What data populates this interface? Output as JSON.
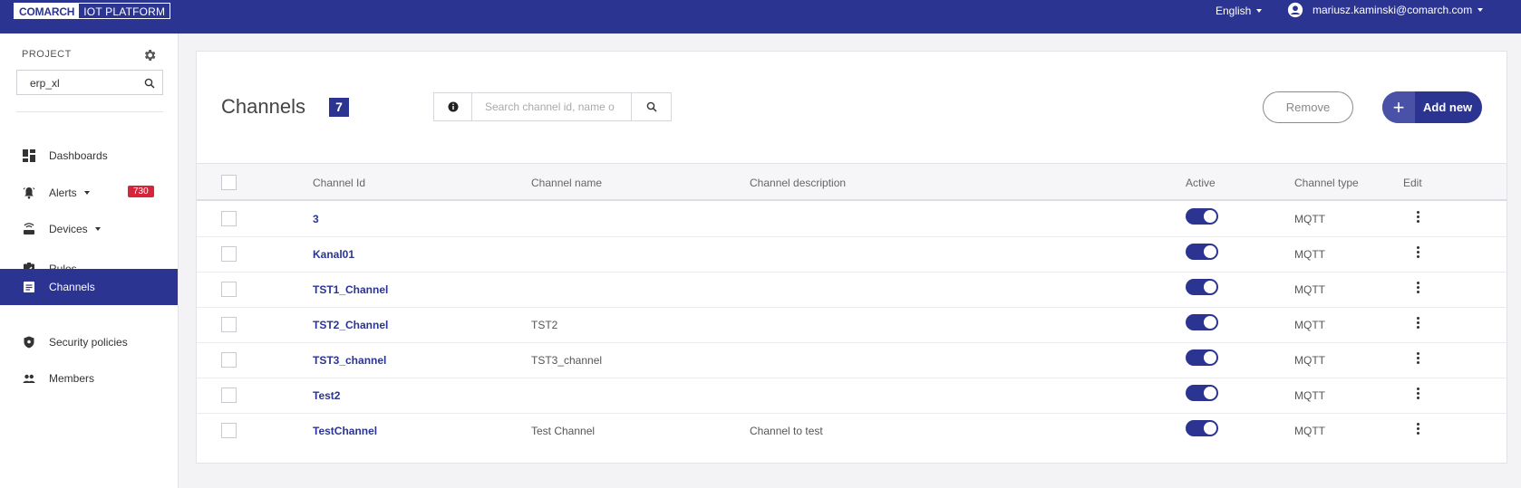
{
  "topbar": {
    "logo_brand": "COMARCH",
    "logo_product": "IOT PLATFORM",
    "language": "English",
    "user_email": "mariusz.kaminski@comarch.com"
  },
  "sidebar": {
    "project_label": "PROJECT",
    "project_value": "erp_xl",
    "items": [
      {
        "label": "Dashboards",
        "icon": "dashboard-icon"
      },
      {
        "label": "Alerts",
        "icon": "bell-icon",
        "badge": "730",
        "dropdown": true
      },
      {
        "label": "Devices",
        "icon": "router-icon",
        "dropdown": true
      },
      {
        "label": "Rules",
        "icon": "checklist-icon"
      },
      {
        "label": "Channels",
        "icon": "list-icon",
        "active": true
      },
      {
        "label": "Security policies",
        "icon": "shield-icon"
      },
      {
        "label": "Members",
        "icon": "people-icon"
      }
    ]
  },
  "main": {
    "title": "Channels",
    "count": "7",
    "search_placeholder": "Search channel id, name o",
    "remove_label": "Remove",
    "add_label": "Add new"
  },
  "table": {
    "columns": [
      "Channel Id",
      "Channel name",
      "Channel description",
      "Active",
      "Channel type",
      "Edit"
    ],
    "rows": [
      {
        "id": "3",
        "name": "",
        "description": "",
        "active": true,
        "type": "MQTT"
      },
      {
        "id": "Kanal01",
        "name": "",
        "description": "",
        "active": true,
        "type": "MQTT"
      },
      {
        "id": "TST1_Channel",
        "name": "",
        "description": "",
        "active": true,
        "type": "MQTT"
      },
      {
        "id": "TST2_Channel",
        "name": "TST2",
        "description": "",
        "active": true,
        "type": "MQTT"
      },
      {
        "id": "TST3_channel",
        "name": "TST3_channel",
        "description": "",
        "active": true,
        "type": "MQTT"
      },
      {
        "id": "Test2",
        "name": "",
        "description": "",
        "active": true,
        "type": "MQTT"
      },
      {
        "id": "TestChannel",
        "name": "Test Channel",
        "description": "Channel to test",
        "active": true,
        "type": "MQTT"
      }
    ]
  },
  "colors": {
    "primary": "#2b3491",
    "badge": "#d6243a"
  }
}
